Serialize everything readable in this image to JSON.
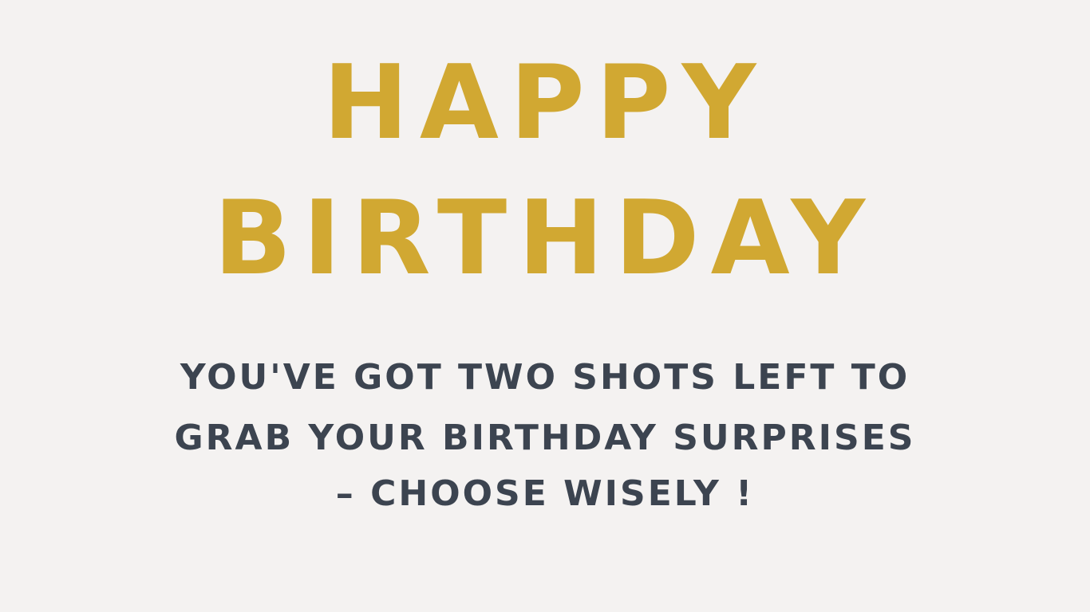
{
  "headline": {
    "line1": "HAPPY",
    "line2": "BIRTHDAY"
  },
  "message": {
    "line1": "YOU'VE GOT TWO SHOTS LEFT TO",
    "line2": "GRAB YOUR BIRTHDAY SURPRISES",
    "line3": "– CHOOSE WISELY !"
  },
  "colors": {
    "background": "#f4f2f1",
    "headline": "#d1a832",
    "message": "#3c4450"
  }
}
